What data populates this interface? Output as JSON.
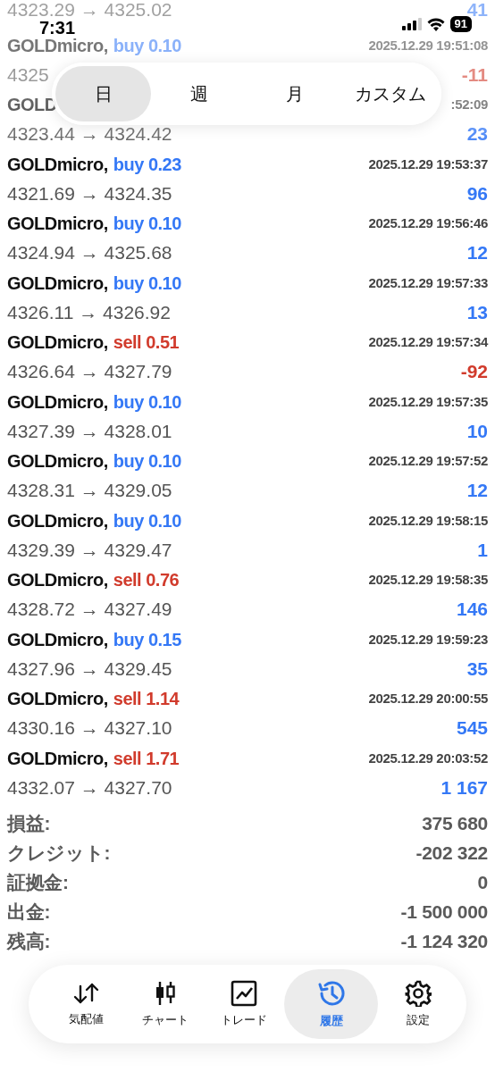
{
  "status_bar": {
    "time": "7:31",
    "battery": "91"
  },
  "period_tabs": [
    {
      "label": "日",
      "selected": true
    },
    {
      "label": "週",
      "selected": false
    },
    {
      "label": "月",
      "selected": false
    },
    {
      "label": "カスタム",
      "selected": false
    }
  ],
  "trades": [
    {
      "prices": "4323.29 → 4325.02",
      "profit": "41",
      "loss": false
    },
    {
      "symbol": "GOLDmicro,",
      "order": "buy 0.10",
      "kind": "buy",
      "time": "2025.12.29 19:51:08",
      "prices": "4325",
      "profit": "-11",
      "loss": true
    },
    {
      "symbol": "GOLD",
      "time": ":52:09",
      "prices": "4323.44 → 4324.42",
      "profit": "23",
      "loss": false
    },
    {
      "symbol": "GOLDmicro,",
      "order": "buy 0.23",
      "kind": "buy",
      "time": "2025.12.29 19:53:37",
      "prices": "4321.69 → 4324.35",
      "profit": "96",
      "loss": false
    },
    {
      "symbol": "GOLDmicro,",
      "order": "buy 0.10",
      "kind": "buy",
      "time": "2025.12.29 19:56:46",
      "prices": "4324.94 → 4325.68",
      "profit": "12",
      "loss": false
    },
    {
      "symbol": "GOLDmicro,",
      "order": "buy 0.10",
      "kind": "buy",
      "time": "2025.12.29 19:57:33",
      "prices": "4326.11 → 4326.92",
      "profit": "13",
      "loss": false
    },
    {
      "symbol": "GOLDmicro,",
      "order": "sell 0.51",
      "kind": "sell",
      "time": "2025.12.29 19:57:34",
      "prices": "4326.64 → 4327.79",
      "profit": "-92",
      "loss": true
    },
    {
      "symbol": "GOLDmicro,",
      "order": "buy 0.10",
      "kind": "buy",
      "time": "2025.12.29 19:57:35",
      "prices": "4327.39 → 4328.01",
      "profit": "10",
      "loss": false
    },
    {
      "symbol": "GOLDmicro,",
      "order": "buy 0.10",
      "kind": "buy",
      "time": "2025.12.29 19:57:52",
      "prices": "4328.31 → 4329.05",
      "profit": "12",
      "loss": false
    },
    {
      "symbol": "GOLDmicro,",
      "order": "buy 0.10",
      "kind": "buy",
      "time": "2025.12.29 19:58:15",
      "prices": "4329.39 → 4329.47",
      "profit": "1",
      "loss": false
    },
    {
      "symbol": "GOLDmicro,",
      "order": "sell 0.76",
      "kind": "sell",
      "time": "2025.12.29 19:58:35",
      "prices": "4328.72 → 4327.49",
      "profit": "146",
      "loss": false
    },
    {
      "symbol": "GOLDmicro,",
      "order": "buy 0.15",
      "kind": "buy",
      "time": "2025.12.29 19:59:23",
      "prices": "4327.96 → 4329.45",
      "profit": "35",
      "loss": false
    },
    {
      "symbol": "GOLDmicro,",
      "order": "sell 1.14",
      "kind": "sell",
      "time": "2025.12.29 20:00:55",
      "prices": "4330.16 → 4327.10",
      "profit": "545",
      "loss": false
    },
    {
      "symbol": "GOLDmicro,",
      "order": "sell 1.71",
      "kind": "sell",
      "time": "2025.12.29 20:03:52",
      "prices": "4332.07 → 4327.70",
      "profit": "1 167",
      "loss": false
    }
  ],
  "summary": [
    {
      "label": "損益:",
      "value": "375 680"
    },
    {
      "label": "クレジット:",
      "value": "-202 322"
    },
    {
      "label": "証拠金:",
      "value": "0"
    },
    {
      "label": "出金:",
      "value": "-1 500 000"
    },
    {
      "label": "残高:",
      "value": "-1 124 320"
    }
  ],
  "nav": [
    {
      "kind": "quotes",
      "label": "気配値",
      "selected": false
    },
    {
      "kind": "chart",
      "label": "チャート",
      "selected": false
    },
    {
      "kind": "trade",
      "label": "トレード",
      "selected": false
    },
    {
      "kind": "history",
      "label": "履歴",
      "selected": true
    },
    {
      "kind": "settings",
      "label": "設定",
      "selected": false
    }
  ]
}
